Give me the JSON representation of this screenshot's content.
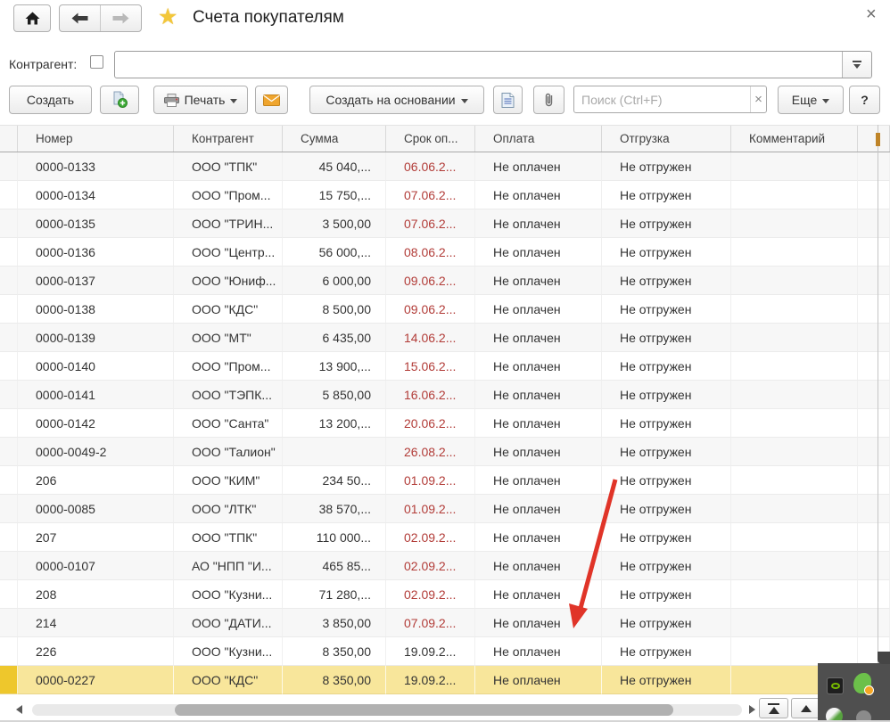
{
  "window": {
    "title": "Счета покупателям",
    "close_glyph": "×"
  },
  "filter": {
    "label": "Контрагент:",
    "value": "",
    "checkbox_checked": false
  },
  "toolbar": {
    "create_label": "Создать",
    "print_label": "Печать",
    "create_based_label": "Создать на основании",
    "more_label": "Еще",
    "help_label": "?",
    "search_placeholder": "Поиск (Ctrl+F)",
    "search_clear_glyph": "×"
  },
  "table": {
    "columns": [
      "Номер",
      "Контрагент",
      "Сумма",
      "Срок оп...",
      "Оплата",
      "Отгрузка",
      "Комментарий"
    ],
    "rows": [
      {
        "number": "0000-0133",
        "counterparty": "ООО \"ТПК\"",
        "amount": "45 040,...",
        "due": "06.06.2...",
        "overdue": true,
        "payment": "Не оплачен",
        "shipment": "Не отгружен",
        "comment": "",
        "highlighted": false
      },
      {
        "number": "0000-0134",
        "counterparty": "ООО \"Пром...",
        "amount": "15 750,...",
        "due": "07.06.2...",
        "overdue": true,
        "payment": "Не оплачен",
        "shipment": "Не отгружен",
        "comment": "",
        "highlighted": false
      },
      {
        "number": "0000-0135",
        "counterparty": "ООО \"ТРИН...",
        "amount": "3 500,00",
        "due": "07.06.2...",
        "overdue": true,
        "payment": "Не оплачен",
        "shipment": "Не отгружен",
        "comment": "",
        "highlighted": false
      },
      {
        "number": "0000-0136",
        "counterparty": "ООО \"Центр...",
        "amount": "56 000,...",
        "due": "08.06.2...",
        "overdue": true,
        "payment": "Не оплачен",
        "shipment": "Не отгружен",
        "comment": "",
        "highlighted": false
      },
      {
        "number": "0000-0137",
        "counterparty": "ООО \"Юниф...",
        "amount": "6 000,00",
        "due": "09.06.2...",
        "overdue": true,
        "payment": "Не оплачен",
        "shipment": "Не отгружен",
        "comment": "",
        "highlighted": false
      },
      {
        "number": "0000-0138",
        "counterparty": "ООО \"КДС\"",
        "amount": "8 500,00",
        "due": "09.06.2...",
        "overdue": true,
        "payment": "Не оплачен",
        "shipment": "Не отгружен",
        "comment": "",
        "highlighted": false
      },
      {
        "number": "0000-0139",
        "counterparty": "ООО \"МТ\"",
        "amount": "6 435,00",
        "due": "14.06.2...",
        "overdue": true,
        "payment": "Не оплачен",
        "shipment": "Не отгружен",
        "comment": "",
        "highlighted": false
      },
      {
        "number": "0000-0140",
        "counterparty": "ООО \"Пром...",
        "amount": "13 900,...",
        "due": "15.06.2...",
        "overdue": true,
        "payment": "Не оплачен",
        "shipment": "Не отгружен",
        "comment": "",
        "highlighted": false
      },
      {
        "number": "0000-0141",
        "counterparty": "ООО \"ТЭПК...",
        "amount": "5 850,00",
        "due": "16.06.2...",
        "overdue": true,
        "payment": "Не оплачен",
        "shipment": "Не отгружен",
        "comment": "",
        "highlighted": false
      },
      {
        "number": "0000-0142",
        "counterparty": "ООО \"Санта\"",
        "amount": "13 200,...",
        "due": "20.06.2...",
        "overdue": true,
        "payment": "Не оплачен",
        "shipment": "Не отгружен",
        "comment": "",
        "highlighted": false
      },
      {
        "number": "0000-0049-2",
        "counterparty": "ООО \"Талион\"",
        "amount": "",
        "due": "26.08.2...",
        "overdue": true,
        "payment": "Не оплачен",
        "shipment": "Не отгружен",
        "comment": "",
        "highlighted": false
      },
      {
        "number": "206",
        "counterparty": "ООО \"КИМ\"",
        "amount": "234 50...",
        "due": "01.09.2...",
        "overdue": true,
        "payment": "Не оплачен",
        "shipment": "Не отгружен",
        "comment": "",
        "highlighted": false
      },
      {
        "number": "0000-0085",
        "counterparty": "ООО \"ЛТК\"",
        "amount": "38 570,...",
        "due": "01.09.2...",
        "overdue": true,
        "payment": "Не оплачен",
        "shipment": "Не отгружен",
        "comment": "",
        "highlighted": false
      },
      {
        "number": "207",
        "counterparty": "ООО \"ТПК\"",
        "amount": "110 000...",
        "due": "02.09.2...",
        "overdue": true,
        "payment": "Не оплачен",
        "shipment": "Не отгружен",
        "comment": "",
        "highlighted": false
      },
      {
        "number": "0000-0107",
        "counterparty": "АО \"НПП \"И...",
        "amount": "465 85...",
        "due": "02.09.2...",
        "overdue": true,
        "payment": "Не оплачен",
        "shipment": "Не отгружен",
        "comment": "",
        "highlighted": false
      },
      {
        "number": "208",
        "counterparty": "ООО \"Кузни...",
        "amount": "71 280,...",
        "due": "02.09.2...",
        "overdue": true,
        "payment": "Не оплачен",
        "shipment": "Не отгружен",
        "comment": "",
        "highlighted": false
      },
      {
        "number": "214",
        "counterparty": "ООО \"ДАТИ...",
        "amount": "3 850,00",
        "due": "07.09.2...",
        "overdue": true,
        "payment": "Не оплачен",
        "shipment": "Не отгружен",
        "comment": "",
        "highlighted": false
      },
      {
        "number": "226",
        "counterparty": "ООО \"Кузни...",
        "amount": "8 350,00",
        "due": "19.09.2...",
        "overdue": false,
        "payment": "Не оплачен",
        "shipment": "Не отгружен",
        "comment": "",
        "highlighted": false
      },
      {
        "number": "0000-0227",
        "counterparty": "ООО \"КДС\"",
        "amount": "8 350,00",
        "due": "19.09.2...",
        "overdue": false,
        "payment": "Не оплачен",
        "shipment": "Не отгружен",
        "comment": "",
        "highlighted": true
      }
    ]
  },
  "colors": {
    "overdue_date": "#b23c38",
    "highlight_row": "#f8e69b",
    "highlight_marker": "#eec72c",
    "annotation_arrow": "#e03428",
    "favorite_star": "#f3c73a",
    "envelope": "#efa52e"
  }
}
